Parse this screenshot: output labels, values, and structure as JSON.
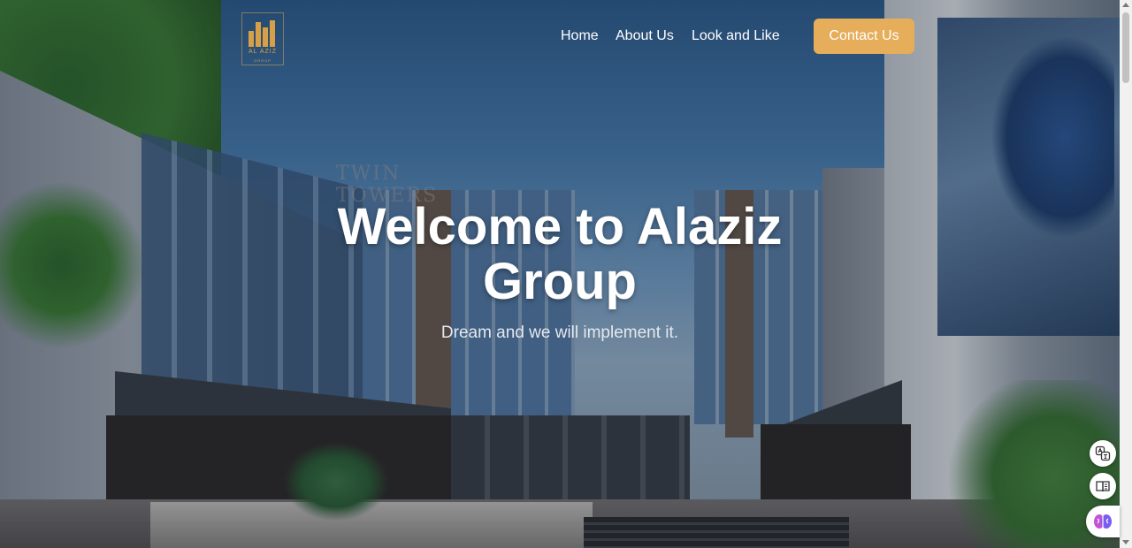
{
  "brand": {
    "logo_name": "AL AZIZ",
    "logo_sub": "GROUP",
    "logo_color": "#d8a046"
  },
  "nav": {
    "items": [
      {
        "label": "Home"
      },
      {
        "label": "About Us"
      },
      {
        "label": "Look and Like"
      }
    ],
    "contact_label": "Contact Us",
    "contact_color": "#e6ad5a"
  },
  "hero": {
    "title": "Welcome to Alaziz Group",
    "subtitle": "Dream and we will implement it.",
    "background_sign": "TWIN TOWERS"
  },
  "extensions": {
    "icons": [
      "translate-icon",
      "reader-icon",
      "brain-icon"
    ]
  }
}
